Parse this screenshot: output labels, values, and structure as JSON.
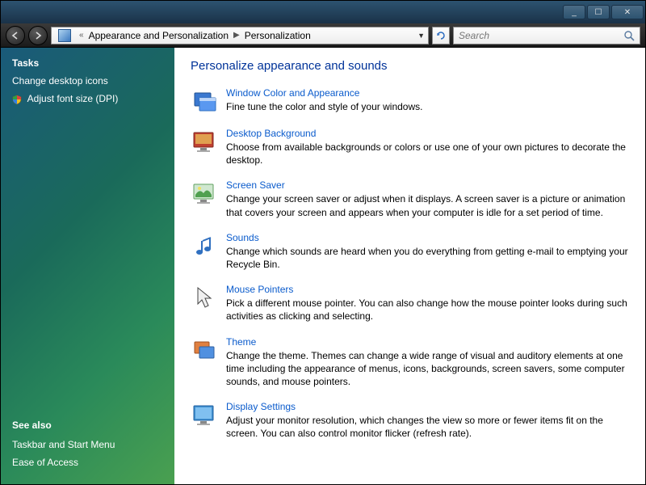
{
  "titlebar": {
    "min": "_",
    "max": "☐",
    "close": "✕"
  },
  "nav": {
    "crumb_root_prefix": "«",
    "crumb1": "Appearance and Personalization",
    "crumb2": "Personalization"
  },
  "search": {
    "placeholder": "Search"
  },
  "sidebar": {
    "tasks_heading": "Tasks",
    "links": [
      {
        "label": "Change desktop icons",
        "shield": false
      },
      {
        "label": "Adjust font size (DPI)",
        "shield": true
      }
    ],
    "seealso_heading": "See also",
    "seealso": [
      {
        "label": "Taskbar and Start Menu"
      },
      {
        "label": "Ease of Access"
      }
    ]
  },
  "main": {
    "heading": "Personalize appearance and sounds",
    "items": [
      {
        "icon": "window-color-icon",
        "title": "Window Color and Appearance",
        "desc": "Fine tune the color and style of your windows."
      },
      {
        "icon": "desktop-bg-icon",
        "title": "Desktop Background",
        "desc": "Choose from available backgrounds or colors or use one of your own pictures to decorate the desktop."
      },
      {
        "icon": "screensaver-icon",
        "title": "Screen Saver",
        "desc": "Change your screen saver or adjust when it displays. A screen saver is a picture or animation that covers your screen and appears when your computer is idle for a set period of time."
      },
      {
        "icon": "sounds-icon",
        "title": "Sounds",
        "desc": "Change which sounds are heard when you do everything from getting e-mail to emptying your Recycle Bin."
      },
      {
        "icon": "mouse-icon",
        "title": "Mouse Pointers",
        "desc": "Pick a different mouse pointer. You can also change how the mouse pointer looks during such activities as clicking and selecting."
      },
      {
        "icon": "theme-icon",
        "title": "Theme",
        "desc": "Change the theme. Themes can change a wide range of visual and auditory elements at one time including the appearance of menus, icons, backgrounds, screen savers, some computer sounds, and mouse pointers."
      },
      {
        "icon": "display-icon",
        "title": "Display Settings",
        "desc": "Adjust your monitor resolution, which changes the view so more or fewer items fit on the screen. You can also control monitor flicker (refresh rate)."
      }
    ]
  }
}
